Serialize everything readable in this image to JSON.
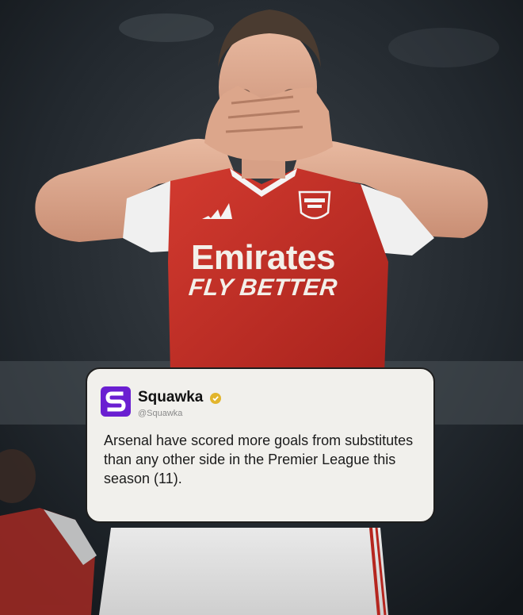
{
  "shirt": {
    "sponsor_main": "Emirates",
    "sponsor_sub": "FLY BETTER"
  },
  "tweet": {
    "account_name": "Squawka",
    "handle": "@Squawka",
    "text": "Arsenal have scored more goals from substitutes than any other side in the Premier League this season (11).",
    "verified": true
  },
  "colors": {
    "logo_bg": "#6a1fd1",
    "verified_badge": "#e2b52c",
    "shirt_red": "#c8322a"
  },
  "icons": [
    "squawka-logo-icon",
    "verified-badge-icon",
    "arsenal-crest-icon",
    "adidas-logo-icon"
  ]
}
